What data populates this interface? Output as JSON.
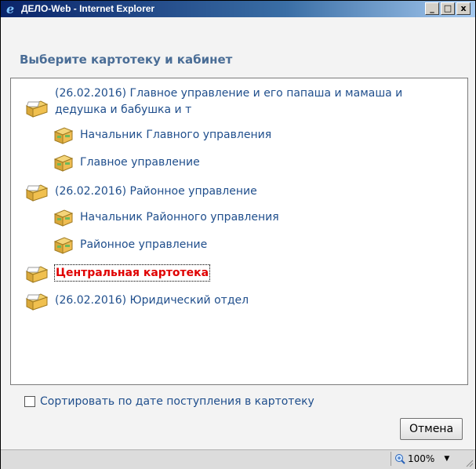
{
  "window": {
    "title": "ДЕЛО-Web - Internet Explorer",
    "controls": {
      "minimize": "_",
      "maximize": "□",
      "close": "x"
    }
  },
  "dialog": {
    "header": "Выберите картотеку и кабинет",
    "items": [
      {
        "label_line1": "(26.02.2016) Главное управление и его папаша и мамаша и",
        "label_line2": "дедушка и бабушка и т",
        "type": "cardfile-icon"
      },
      {
        "label": "Начальник Главного управления",
        "type": "cabinet-icon"
      },
      {
        "label": "Главное управление",
        "type": "cabinet-icon"
      },
      {
        "label": "(26.02.2016) Районное управление",
        "type": "cardfile-icon"
      },
      {
        "label": "Начальник Районного управления",
        "type": "cabinet-icon"
      },
      {
        "label": "Районное управление",
        "type": "cabinet-icon"
      },
      {
        "label": "Центральная картотека",
        "type": "cardfile-icon",
        "selected": true
      },
      {
        "label": "(26.02.2016) Юридический отдел",
        "type": "cardfile-icon"
      }
    ],
    "sort_checkbox": {
      "label": "Сортировать по дате поступления в картотеку",
      "checked": false
    },
    "cancel_button": "Отмена"
  },
  "statusbar": {
    "zoom": "100%"
  },
  "colors": {
    "link": "#1f4e8c",
    "selected": "#e00000",
    "header": "#4a6d96"
  }
}
